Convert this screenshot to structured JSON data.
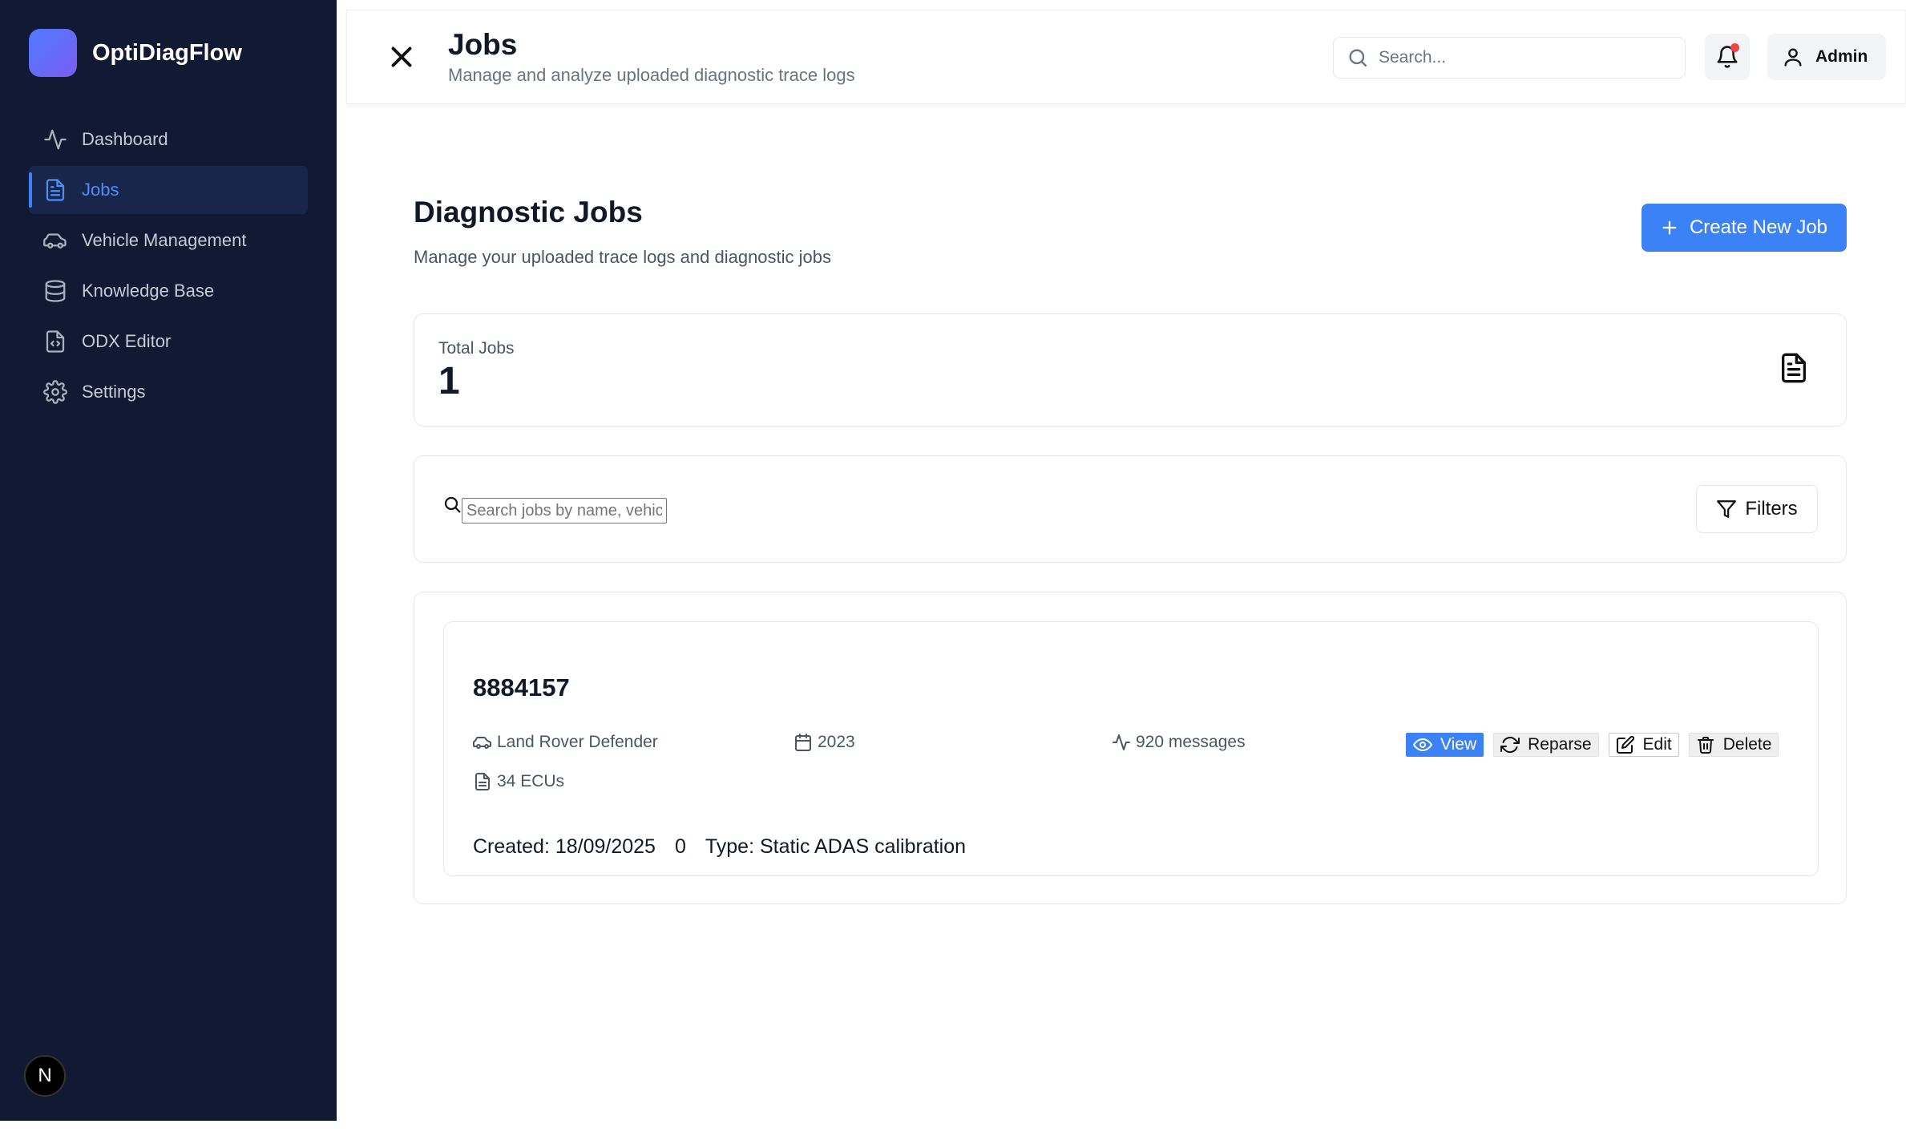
{
  "app": {
    "name": "OptiDiagFlow"
  },
  "sidebar": {
    "items": [
      {
        "label": "Dashboard",
        "icon": "activity-icon"
      },
      {
        "label": "Jobs",
        "icon": "file-text-icon",
        "active": true
      },
      {
        "label": "Vehicle Management",
        "icon": "car-icon"
      },
      {
        "label": "Knowledge Base",
        "icon": "database-icon"
      },
      {
        "label": "ODX Editor",
        "icon": "file-code-icon"
      },
      {
        "label": "Settings",
        "icon": "gear-icon"
      }
    ],
    "badge": "N"
  },
  "header": {
    "title": "Jobs",
    "subtitle": "Manage and analyze uploaded diagnostic trace logs",
    "search_placeholder": "Search...",
    "user_label": "Admin"
  },
  "main": {
    "title": "Diagnostic Jobs",
    "subtitle": "Manage your uploaded trace logs and diagnostic jobs",
    "create_label": "Create New Job",
    "stats": {
      "label": "Total Jobs",
      "value": "1"
    },
    "filter": {
      "placeholder": "Search jobs by name, vehicle...",
      "filters_label": "Filters"
    },
    "jobs": [
      {
        "id": "8884157",
        "vehicle": "Land Rover Defender",
        "year": "2023",
        "messages": "920 messages",
        "ecus": "34 ECUs",
        "created": "Created: 18/09/2025",
        "count": "0",
        "type": "Type: Static ADAS calibration",
        "actions": {
          "view": "View",
          "reparse": "Reparse",
          "edit": "Edit",
          "delete": "Delete"
        }
      }
    ]
  },
  "colors": {
    "sidebar_bg": "#111a32",
    "accent": "#3b82f6",
    "notification_dot": "#ef4444"
  }
}
